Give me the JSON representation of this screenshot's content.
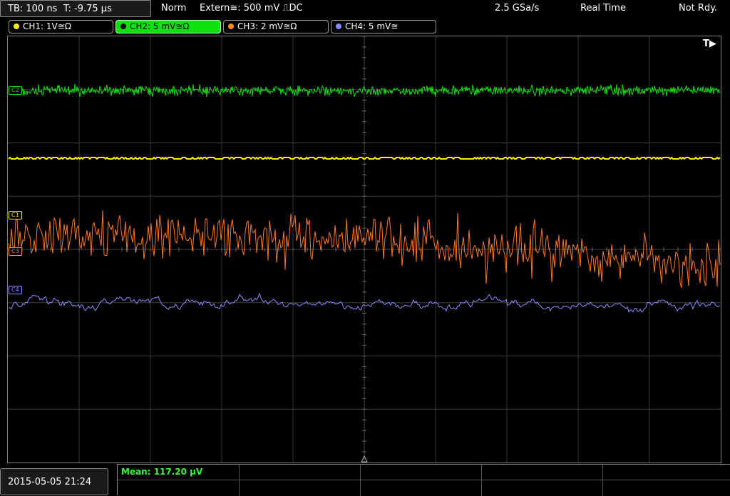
{
  "status": {
    "timebase": "TB: 100 ns",
    "trigger_time": "T: -9.75 µs",
    "mode": "Norm",
    "trigger_source": "Extern≅: 500 mV ⎍DC",
    "sample_rate": "2.5 GSa/s",
    "acq_mode": "Real Time",
    "ready": "Not Rdy."
  },
  "channels": [
    {
      "label": "CH1: 1V≅Ω",
      "color": "#ffee00"
    },
    {
      "label": "CH2: 5 mV≅Ω",
      "color": "#10e010"
    },
    {
      "label": "CH3: 2 mV≅Ω",
      "color": "#ff8a1a"
    },
    {
      "label": "CH4: 5 mV≅",
      "color": "#8888ff"
    }
  ],
  "markers": {
    "c1": "C1",
    "c2": "C2",
    "c3": "C3",
    "c4": "C4"
  },
  "trigger_marker": "T▶",
  "measurement": "Mean: 117.20 µV",
  "datetime": "2015-05-05 21:24"
}
